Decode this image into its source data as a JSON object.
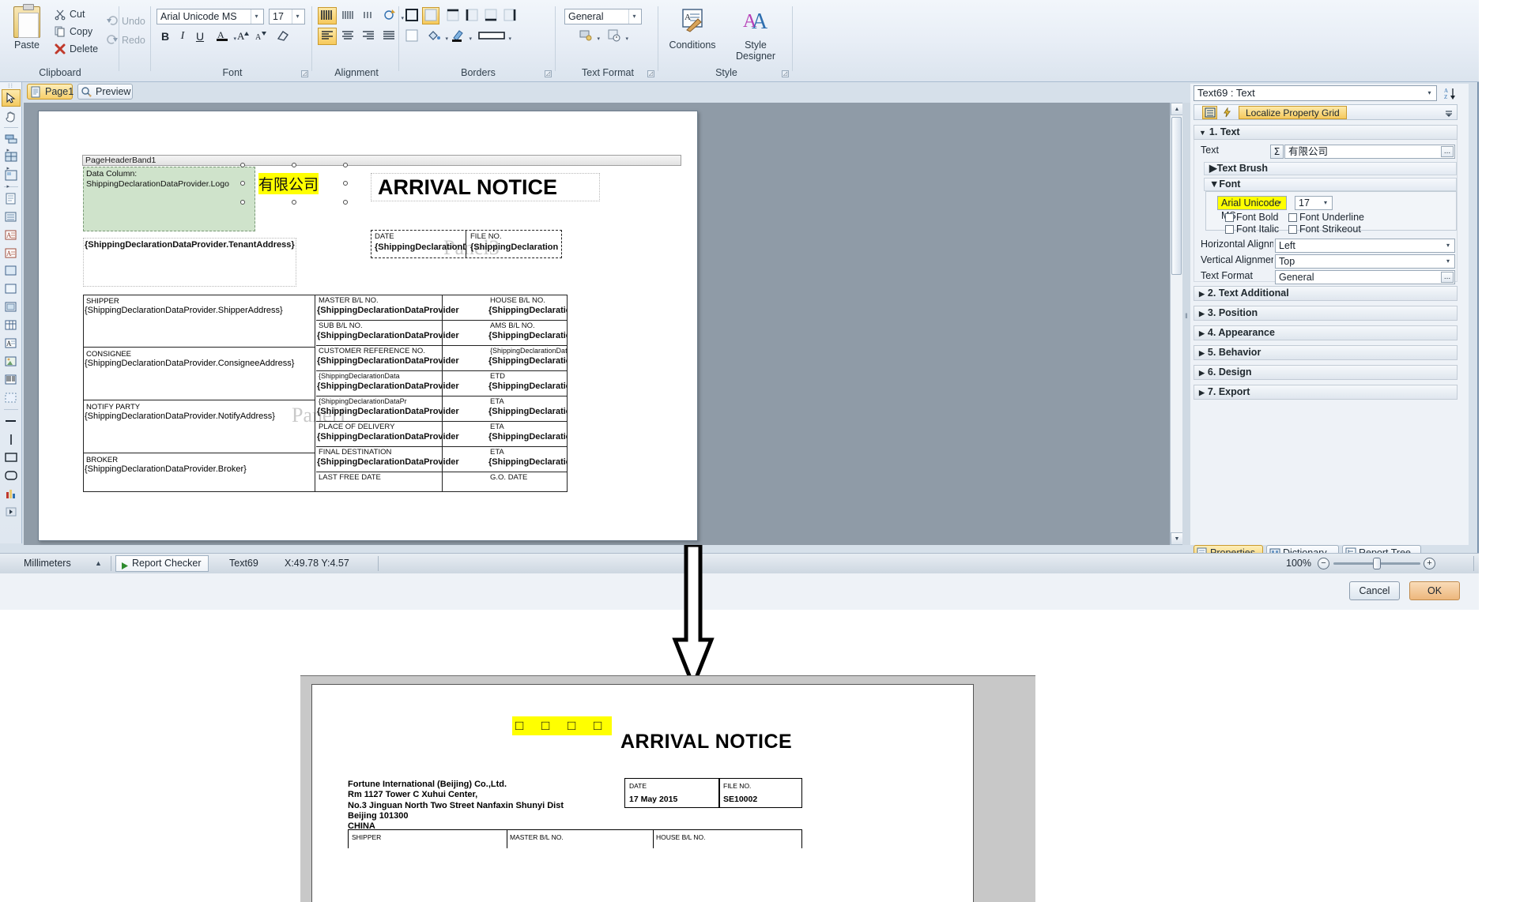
{
  "ribbon": {
    "clipboard": {
      "group_label": "Clipboard",
      "paste": "Paste",
      "cut": "Cut",
      "copy": "Copy",
      "delete": "Delete"
    },
    "history": {
      "undo": "Undo",
      "redo": "Redo"
    },
    "font": {
      "group_label": "Font",
      "family": "Arial Unicode MS",
      "size": "17",
      "bold": "B",
      "italic": "I",
      "underline": "U"
    },
    "alignment": {
      "group_label": "Alignment"
    },
    "borders": {
      "group_label": "Borders"
    },
    "text_format": {
      "group_label": "Text Format",
      "value": "General"
    },
    "style": {
      "group_label": "Style",
      "conditions": "Conditions",
      "style_designer": "Style Designer"
    }
  },
  "designer_tabs": [
    {
      "label": "Page1",
      "icon": "page-icon",
      "active": true
    },
    {
      "label": "Preview",
      "icon": "preview-icon",
      "active": false
    }
  ],
  "report": {
    "band_label": "PageHeaderBand1",
    "logo_placeholder_line1": "Data Column:",
    "logo_placeholder_line2": "ShippingDeclarationDataProvider.Logo",
    "selected_text": "有限公司",
    "tenant_address": "{ShippingDeclarationDataProvider.TenantAddress}",
    "title": "ARRIVAL NOTICE",
    "panel_watermark": "Panel3",
    "panel_watermark2": "Panel1",
    "date_caption": "DATE",
    "date_expr": "{ShippingDeclarationD",
    "file_caption": "FILE NO.",
    "file_expr": "{ShippingDeclaration",
    "left_blocks": [
      {
        "caption": "SHIPPER",
        "expr": "{ShippingDeclarationDataProvider.ShipperAddress}"
      },
      {
        "caption": "CONSIGNEE",
        "expr": "{ShippingDeclarationDataProvider.ConsigneeAddress}"
      },
      {
        "caption": "NOTIFY PARTY",
        "expr": "{ShippingDeclarationDataProvider.NotifyAddress}"
      },
      {
        "caption": "BROKER",
        "expr": "{ShippingDeclarationDataProvider.Broker}"
      }
    ],
    "grid_rows": [
      {
        "left_caption": "MASTER B/L NO.",
        "left_expr": "{ShippingDeclarationDataProvider",
        "right_caption": "HOUSE B/L NO.",
        "right_expr": "{ShippingDeclarationDataProvider"
      },
      {
        "left_caption": "SUB B/L NO.",
        "left_expr": "{ShippingDeclarationDataProvider",
        "right_caption": "AMS B/L NO.",
        "right_expr": "{ShippingDeclarationDataProvider"
      },
      {
        "left_caption": "CUSTOMER REFERENCE NO.",
        "left_expr": "{ShippingDeclarationDataProvider",
        "right_caption": "{ShippingDeclarationDataProvider.CarrierN",
        "right_expr": "{ShippingDeclarationDataProvider"
      },
      {
        "left_caption": "{ShippingDeclarationData",
        "left_expr": "{ShippingDeclarationDataProvider",
        "right_caption": "ETD",
        "right_expr": "{ShippingDeclarationDataProvider"
      },
      {
        "left_caption": "{ShippingDeclarationDataPr",
        "left_expr": "{ShippingDeclarationDataProvider",
        "right_caption": "ETA",
        "right_expr": "{ShippingDeclarationDataProvider"
      },
      {
        "left_caption": "PLACE OF DELIVERY",
        "left_expr": "{ShippingDeclarationDataProvider",
        "right_caption": "ETA",
        "right_expr": "{ShippingDeclarationDataProvider"
      },
      {
        "left_caption": "FINAL DESTINATION",
        "left_expr": "{ShippingDeclarationDataProvider",
        "right_caption": "ETA",
        "right_expr": "{ShippingDeclarationDataProvide"
      },
      {
        "left_caption": "LAST FREE DATE",
        "left_expr": "",
        "right_caption": "G.O. DATE",
        "right_expr": ""
      }
    ]
  },
  "properties": {
    "selector": "Text69 : Text",
    "localize_button": "Localize Property Grid",
    "categories": [
      {
        "label": "1. Text",
        "expanded": true
      },
      {
        "label": "2. Text Additional",
        "expanded": false
      },
      {
        "label": "3. Position",
        "expanded": false
      },
      {
        "label": "4. Appearance",
        "expanded": false
      },
      {
        "label": "5. Behavior",
        "expanded": false
      },
      {
        "label": "6. Design",
        "expanded": false
      },
      {
        "label": "7. Export",
        "expanded": false
      }
    ],
    "text_label": "Text",
    "text_value": "有限公司",
    "sigma": "Σ",
    "ellipsis": "...",
    "text_brush_label": "Text Brush",
    "font_label": "Font",
    "font_family": "Arial Unicode MS",
    "font_size": "17",
    "font_bold": "Font Bold",
    "font_underline": "Font Underline",
    "font_italic": "Font Italic",
    "font_strikeout": "Font Strikeout",
    "halign_label": "Horizontal Alignme",
    "halign_value": "Left",
    "valign_label": "Vertical Alignment",
    "valign_value": "Top",
    "textformat_label": "Text Format",
    "textformat_value": "General"
  },
  "panel_tabs": [
    {
      "label": "Properties",
      "icon": "properties-icon",
      "active": true
    },
    {
      "label": "Dictionary",
      "icon": "dictionary-icon",
      "active": false
    },
    {
      "label": "Report Tree",
      "icon": "report-tree-icon",
      "active": false
    }
  ],
  "statusbar": {
    "units": "Millimeters",
    "report_checker": "Report Checker",
    "selection": "Text69",
    "coords": "X:49.78  Y:4.57",
    "zoom": "100%",
    "zoom_out": "−",
    "zoom_in": "+"
  },
  "dialog": {
    "cancel": "Cancel",
    "ok": "OK"
  },
  "preview": {
    "logo_boxes": "□ □ □ □",
    "title": "ARRIVAL NOTICE",
    "address": "Fortune International (Beijing) Co.,Ltd.\nRm 1127 Tower C Xuhui Center,\nNo.3 Jinguan North Two Street Nanfaxin Shunyi Dist\nBeijing 101300\nCHINA",
    "date_caption": "DATE",
    "date_value": "17 May 2015",
    "file_caption": "FILE NO.",
    "file_value": "SE10002",
    "table_headers": [
      "SHIPPER",
      "MASTER B/L NO.",
      "HOUSE B/L NO."
    ]
  },
  "colors": {
    "accent_yellow": "#ffff00",
    "highlight_orange": "#f3c95f",
    "logo_green": "#cfe3cb",
    "canvas_gray": "#8f9ba7"
  }
}
